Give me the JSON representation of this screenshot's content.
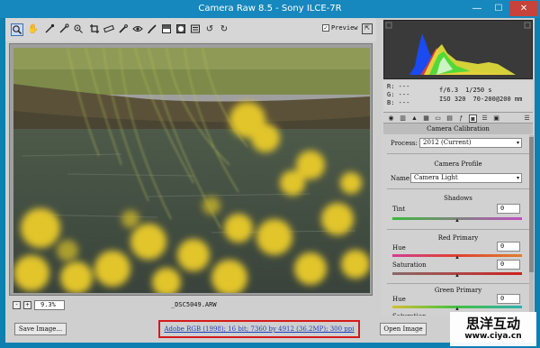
{
  "window": {
    "title": "Camera Raw 8.5  -  Sony ILCE-7R",
    "minimize": "—",
    "maximize": "☐",
    "close": "✕"
  },
  "toolbar": {
    "tools": [
      "zoom-icon",
      "hand-icon",
      "white-balance-icon",
      "color-sampler-icon",
      "target-adjust-icon",
      "crop-icon",
      "straighten-icon",
      "spot-removal-icon",
      "red-eye-icon",
      "adjustment-brush-icon",
      "graduated-filter-icon",
      "radial-filter-icon",
      "preferences-icon",
      "rotate-left-icon",
      "rotate-right-icon"
    ],
    "preview_label": "Preview",
    "preview_checked": true,
    "preview_check": "✓"
  },
  "status": {
    "zoom": "9.3%",
    "filename": "_DSC5049.ARW",
    "zoom_minus": "-",
    "zoom_plus": "+"
  },
  "info": {
    "r_label": "R:",
    "g_label": "G:",
    "b_label": "B:",
    "r_value": "---",
    "g_value": "---",
    "b_value": "---",
    "aperture": "f/6.3",
    "shutter": "1/250 s",
    "iso": "ISO 320",
    "lens": "70-200@200 mm"
  },
  "panel": {
    "section_title": "Camera Calibration",
    "process_label": "Process:",
    "process_value": "2012 (Current)",
    "camera_profile_title": "Camera Profile",
    "name_label": "Name:",
    "name_value": "Camera Light",
    "shadows_title": "Shadows",
    "tint_label": "Tint",
    "tint_value": "0",
    "red_primary_title": "Red Primary",
    "red_hue_label": "Hue",
    "red_hue_value": "0",
    "red_sat_label": "Saturation",
    "red_sat_value": "0",
    "green_primary_title": "Green Primary",
    "green_hue_label": "Hue",
    "green_hue_value": "0",
    "green_sat_label": "Saturation"
  },
  "bottom": {
    "save_label": "Save Image...",
    "workflow_link": "Adobe RGB (1998); 16 bit; 7360 by 4912 (36.2MP); 300 ppi",
    "open_label": "Open Image"
  },
  "watermark": {
    "chinese": "思洋互动",
    "url": "www.ciya.cn"
  },
  "colors": {
    "titlebar": "#1688bd",
    "close": "#c7423a",
    "link": "#1b3fbe",
    "highlight_box": "#d41a1a"
  }
}
